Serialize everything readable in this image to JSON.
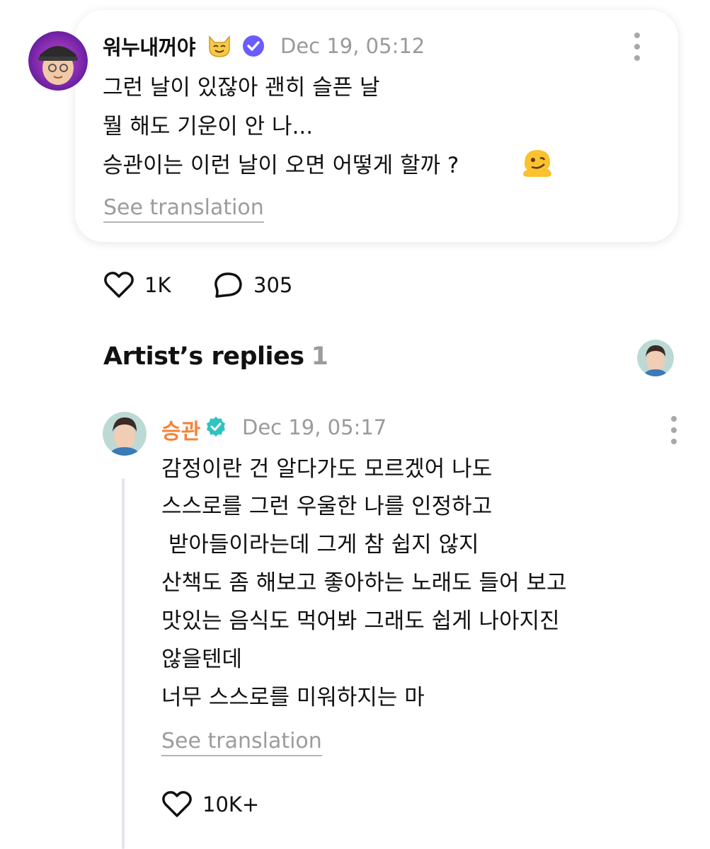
{
  "post": {
    "username": "워누내꺼야",
    "timestamp": "Dec 19, 05:12",
    "lines": [
      "그런 날이 있잖아 괜히 슬픈 날",
      "뭘 해도 기운이 안 나...",
      "승관이는 이런 날이 오면 어떻게 할까 ?"
    ],
    "see_translation": "See translation",
    "like_count": "1K",
    "reply_count": "305"
  },
  "section": {
    "title": "Artist’s replies",
    "count": "1"
  },
  "reply": {
    "username": "승관",
    "timestamp": "Dec 19, 05:17",
    "lines": [
      "감정이란 건 알다가도 모르겠어 나도",
      "스스로를 그런 우울한 나를 인정하고",
      " 받아들이라는데 그게 참 쉽지 않지",
      "산책도 좀 해보고 좋아하는 노래도 들어 보고",
      "맛있는 음식도 먹어봐 그래도 쉽게 나아지진",
      "않을텐데",
      "너무 스스로를 미워하지는 마"
    ],
    "see_translation": "See translation",
    "like_count": "10K+"
  },
  "colors": {
    "artist_name": "#f5833a",
    "verified_blue": "#6a5cff",
    "verified_teal": "#2ec4c0",
    "muted": "#9c9c9c"
  },
  "icons": {
    "cat_emoji": "cat-face-icon",
    "melting_emoji": "melting-face-icon",
    "like": "heart-icon",
    "reply": "speech-bubble-icon",
    "menu": "kebab-menu-icon"
  }
}
